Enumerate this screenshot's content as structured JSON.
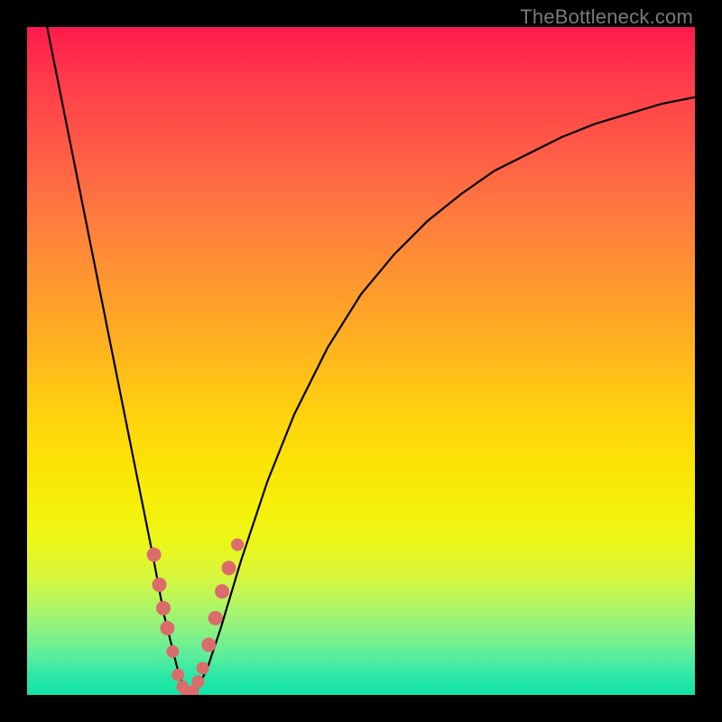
{
  "watermark": "TheBottleneck.com",
  "colors": {
    "frame_bg": "#000000",
    "curve": "#000000",
    "markers": "#dc6c6c"
  },
  "chart_data": {
    "type": "line",
    "title": "",
    "xlabel": "",
    "ylabel": "",
    "xlim": [
      0,
      100
    ],
    "ylim": [
      0,
      100
    ],
    "grid": false,
    "series": [
      {
        "name": "bottleneck-curve",
        "x": [
          3,
          5,
          7,
          9,
          11,
          13,
          15,
          17,
          19,
          20.5,
          21.5,
          22.5,
          23.5,
          24.5,
          25.5,
          27,
          29,
          32,
          36,
          40,
          45,
          50,
          55,
          60,
          65,
          70,
          75,
          80,
          85,
          90,
          95,
          100
        ],
        "values": [
          100,
          90,
          80,
          70,
          60,
          50,
          40,
          30,
          20,
          12,
          8,
          4,
          1,
          0,
          1,
          4,
          10,
          20,
          32,
          42,
          52,
          60,
          66,
          71,
          75,
          78.5,
          81,
          83.5,
          85.5,
          87,
          88.5,
          89.5
        ]
      }
    ],
    "markers": {
      "name": "data-points",
      "radius_base": 7,
      "points": [
        {
          "x": 19.0,
          "y": 21.0,
          "r": 8
        },
        {
          "x": 19.8,
          "y": 16.5,
          "r": 8
        },
        {
          "x": 20.4,
          "y": 13.0,
          "r": 8
        },
        {
          "x": 21.0,
          "y": 10.0,
          "r": 8
        },
        {
          "x": 21.8,
          "y": 6.5,
          "r": 7
        },
        {
          "x": 22.6,
          "y": 3.0,
          "r": 7
        },
        {
          "x": 23.3,
          "y": 1.2,
          "r": 7
        },
        {
          "x": 24.0,
          "y": 0.0,
          "r": 7
        },
        {
          "x": 24.8,
          "y": 0.5,
          "r": 7
        },
        {
          "x": 25.6,
          "y": 2.0,
          "r": 7
        },
        {
          "x": 26.3,
          "y": 4.0,
          "r": 7
        },
        {
          "x": 27.2,
          "y": 7.5,
          "r": 8
        },
        {
          "x": 28.2,
          "y": 11.5,
          "r": 8
        },
        {
          "x": 29.2,
          "y": 15.5,
          "r": 8
        },
        {
          "x": 30.2,
          "y": 19.0,
          "r": 8
        },
        {
          "x": 31.5,
          "y": 22.5,
          "r": 7
        }
      ]
    }
  }
}
